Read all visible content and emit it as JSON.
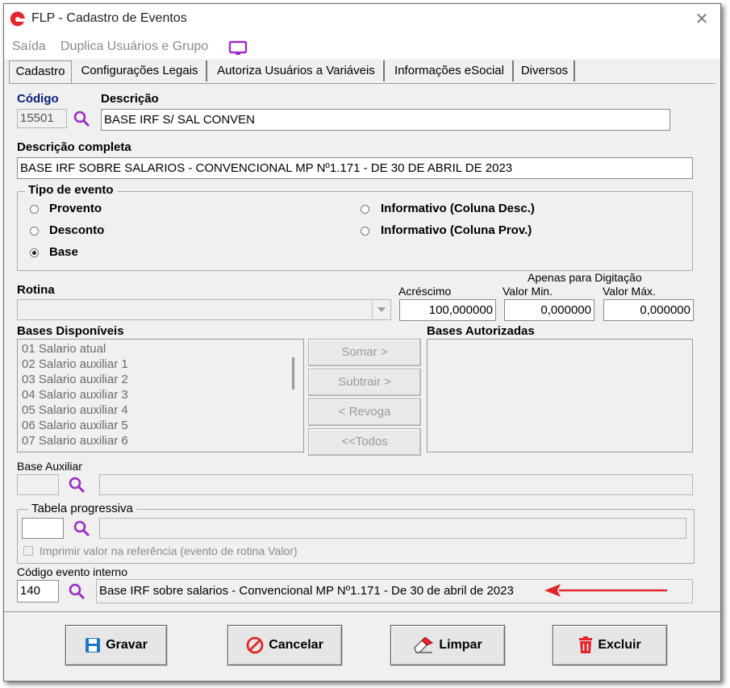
{
  "window": {
    "title": "FLP - Cadastro de Eventos",
    "close": "✕"
  },
  "menubar": {
    "saida": "Saída",
    "duplica": "Duplica Usuários e Grupo"
  },
  "tabs": [
    "Cadastro",
    "Configurações Legais",
    "Autoriza Usuários a Variáveis",
    "Informações eSocial",
    "Diversos"
  ],
  "form": {
    "codigo_label": "Código",
    "codigo_value": "15501",
    "descricao_label": "Descrição",
    "descricao_value": "BASE IRF S/ SAL CONVEN",
    "descricao_completa_label": "Descrição completa",
    "descricao_completa_value": "BASE IRF SOBRE SALARIOS - CONVENCIONAL MP Nº1.171 - DE 30 DE ABRIL DE 2023"
  },
  "tipo_evento": {
    "label": "Tipo de evento",
    "options": [
      "Provento",
      "Desconto",
      "Base",
      "Informativo (Coluna Desc.)",
      "Informativo (Coluna Prov.)"
    ],
    "selected": "Base"
  },
  "rotina": {
    "label": "Rotina",
    "value": "",
    "apenas_label": "Apenas para Digitação",
    "acrescimo_label": "Acréscimo",
    "acrescimo_value": "100,000000",
    "valor_min_label": "Valor Min.",
    "valor_min_value": "0,000000",
    "valor_max_label": "Valor Máx.",
    "valor_max_value": "0,000000"
  },
  "bases": {
    "disponiveis_label": "Bases Disponíveis",
    "autorizadas_label": "Bases Autorizadas",
    "items": [
      "01 Salario atual",
      "02 Salario auxiliar 1",
      "03 Salario auxiliar 2",
      "04 Salario auxiliar 3",
      "05 Salario auxiliar 4",
      "06 Salario auxiliar 5",
      "07 Salario auxiliar 6"
    ],
    "buttons": {
      "somar": "Somar >",
      "subtrair": "Subtrair >",
      "revoga": "< Revoga",
      "todos": "<<Todos"
    }
  },
  "base_auxiliar": {
    "label": "Base Auxiliar",
    "code": "",
    "desc": ""
  },
  "tabela_progressiva": {
    "label": "Tabela progressiva",
    "code": "",
    "desc": "",
    "checkbox_label": "Imprimir valor na referência (evento de rotina Valor)"
  },
  "codigo_interno": {
    "label": "Código evento interno",
    "code": "140",
    "desc": "Base IRF sobre salarios - Convencional MP Nº1.171 - De 30 de abril de 2023"
  },
  "footer": {
    "gravar": "Gravar",
    "cancelar": "Cancelar",
    "limpar": "Limpar",
    "excluir": "Excluir"
  },
  "colors": {
    "accent_red": "#e3262a",
    "label_blue": "#0a1e7a",
    "search_purple": "#9b2ec5"
  }
}
